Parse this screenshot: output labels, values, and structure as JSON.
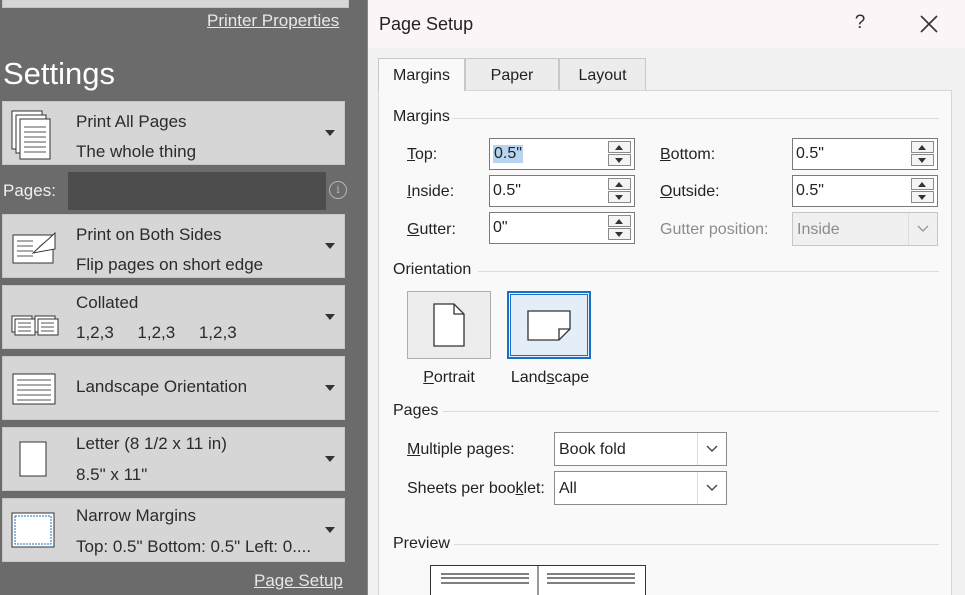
{
  "backstage": {
    "printer_properties_link": "Printer Properties",
    "settings_heading": "Settings",
    "cards": [
      {
        "title": "Print All Pages",
        "subtitle": "The whole thing",
        "icon": "pages-stack-icon"
      },
      {
        "title": "Print on Both Sides",
        "subtitle": "Flip pages on short edge",
        "icon": "duplex-print-icon"
      },
      {
        "title": "Collated",
        "subtitle": "1,2,3     1,2,3     1,2,3",
        "icon": "collated-icon"
      },
      {
        "title": "Landscape Orientation",
        "icon": "landscape-page-icon"
      },
      {
        "title": "Letter (8 1/2 x 11 in)",
        "subtitle": "8.5\" x 11\"",
        "icon": "letter-paper-icon"
      },
      {
        "title": "Narrow Margins",
        "subtitle": "Top: 0.5\" Bottom: 0.5\" Left: 0....",
        "icon": "narrow-margins-icon"
      }
    ],
    "pages_label": "Pages:",
    "pages_value": "",
    "page_setup_link": "Page Setup"
  },
  "dialog": {
    "title": "Page Setup",
    "help_label": "?",
    "tabs": [
      "Margins",
      "Paper",
      "Layout"
    ],
    "active_tab": "Margins",
    "margins": {
      "group_label": "Margins",
      "top_label_pre": "",
      "top_label_u": "T",
      "top_label_post": "op:",
      "top_value": "0.5\"",
      "inside_label_pre": "",
      "inside_label_u": "I",
      "inside_label_post": "nside:",
      "inside_value": "0.5\"",
      "gutter_label_pre": "",
      "gutter_label_u": "G",
      "gutter_label_post": "utter:",
      "gutter_value": "0\"",
      "bottom_label_pre": "",
      "bottom_label_u": "B",
      "bottom_label_post": "ottom:",
      "bottom_value": "0.5\"",
      "outside_label_pre": "",
      "outside_label_u": "O",
      "outside_label_post": "utside:",
      "outside_value": "0.5\"",
      "gutter_position_label": "Gutter position:",
      "gutter_position_value": "Inside"
    },
    "orientation": {
      "group_label": "Orientation",
      "portrait_pre": "",
      "portrait_u": "P",
      "portrait_post": "ortrait",
      "landscape_pre": "Land",
      "landscape_u": "s",
      "landscape_post": "cape",
      "selected": "landscape"
    },
    "pages": {
      "group_label": "Pages",
      "multiple_label_pre": "",
      "multiple_label_u": "M",
      "multiple_label_post": "ultiple pages:",
      "multiple_value": "Book fold",
      "sheets_label_pre": "Sheets per boo",
      "sheets_label_u": "k",
      "sheets_label_post": "let:",
      "sheets_value": "All"
    },
    "preview": {
      "group_label": "Preview"
    }
  },
  "colors": {
    "accent": "#1a6fc4",
    "selection": "#b7d4f1"
  }
}
